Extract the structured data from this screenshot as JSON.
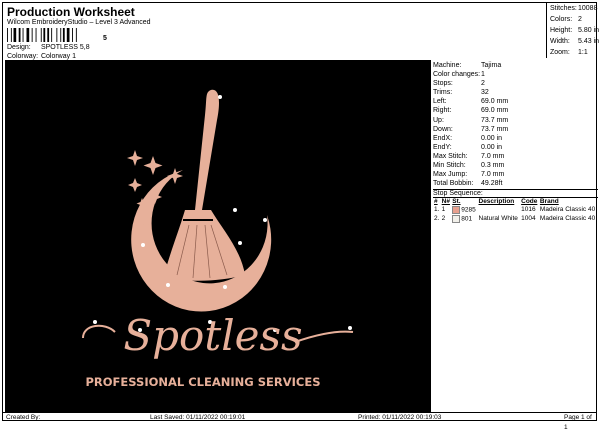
{
  "header": {
    "title": "Production Worksheet",
    "subtitle": "Wilcom EmbroideryStudio – Level 3 Advanced",
    "barcode_text": "5",
    "design_label": "Design:",
    "design_value": "SPOTLESS 5,8",
    "colorway_label": "Colorway:",
    "colorway_value": "Colorway 1"
  },
  "stats": [
    {
      "label": "Stitches:",
      "value": "10088"
    },
    {
      "label": "Colors:",
      "value": "2"
    },
    {
      "label": "Height:",
      "value": "5.80 in"
    },
    {
      "label": "Width:",
      "value": "5.43 in"
    },
    {
      "label": "Zoom:",
      "value": "1:1"
    }
  ],
  "machine_info": [
    {
      "label": "Machine:",
      "value": "Tajima"
    },
    {
      "label": "Color changes:",
      "value": "1"
    },
    {
      "label": "Stops:",
      "value": "2"
    },
    {
      "label": "Trims:",
      "value": "32"
    },
    {
      "label": "Left:",
      "value": "69.0 mm"
    },
    {
      "label": "Right:",
      "value": "69.0 mm"
    },
    {
      "label": "Up:",
      "value": "73.7 mm"
    },
    {
      "label": "Down:",
      "value": "73.7 mm"
    },
    {
      "label": "EndX:",
      "value": "0.00 in"
    },
    {
      "label": "EndY:",
      "value": "0.00 in"
    },
    {
      "label": "Max Stitch:",
      "value": "7.0 mm"
    },
    {
      "label": "Min Stitch:",
      "value": "0.3 mm"
    },
    {
      "label": "Max Jump:",
      "value": "7.0 mm"
    },
    {
      "label": "Total Bobbin:",
      "value": "49.28ft"
    }
  ],
  "stop_sequence": {
    "title": "Stop Sequence:",
    "columns": [
      "#",
      "N#",
      "St.",
      "Description",
      "Code",
      "Brand"
    ],
    "rows": [
      {
        "num": "1.",
        "n": "1",
        "color": "#e8a08e",
        "st": "9285",
        "desc": "",
        "code": "1016",
        "brand": "Madeira Classic 40"
      },
      {
        "num": "2.",
        "n": "2",
        "color": "#f2f0ea",
        "st": "801",
        "desc": "Natural White",
        "code": "1004",
        "brand": "Madeira Classic 40"
      }
    ]
  },
  "design": {
    "brand_text": "Spotless",
    "tagline": "PROFESSIONAL CLEANING SERVICES",
    "main_color": "#e7b09a",
    "sparkle_color": "#ffffff"
  },
  "footer": {
    "created_by": "Created By:",
    "last_saved": "Last Saved: 01/11/2022 00:19:01",
    "printed": "Printed: 01/11/2022 00:19:03",
    "page": "Page 1 of 1"
  }
}
